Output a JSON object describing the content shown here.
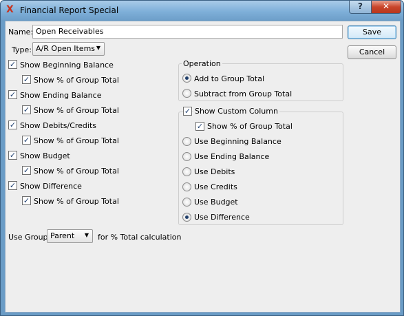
{
  "window": {
    "title": "Financial Report Special",
    "help_glyph": "?",
    "close_glyph": "✕",
    "app_icon_glyph": "X"
  },
  "form": {
    "name_label": "Name:",
    "name_value": "Open Receivables",
    "type_label": "Type:",
    "type_value": "A/R Open Items"
  },
  "buttons": {
    "save": "Save",
    "cancel": "Cancel"
  },
  "show_options": [
    {
      "label": "Show Beginning Balance",
      "checked": true,
      "pct_label": "Show % of Group Total",
      "pct_checked": true
    },
    {
      "label": "Show Ending Balance",
      "checked": true,
      "pct_label": "Show % of Group Total",
      "pct_checked": true
    },
    {
      "label": "Show Debits/Credits",
      "checked": true,
      "pct_label": "Show % of Group Total",
      "pct_checked": true
    },
    {
      "label": "Show Budget",
      "checked": true,
      "pct_label": "Show % of Group Total",
      "pct_checked": true
    },
    {
      "label": "Show Difference",
      "checked": true,
      "pct_label": "Show % of Group Total",
      "pct_checked": true
    }
  ],
  "operation": {
    "title": "Operation",
    "options": [
      {
        "label": "Add to Group Total",
        "selected": true
      },
      {
        "label": "Subtract from Group Total",
        "selected": false
      }
    ]
  },
  "custom_column": {
    "label": "Show Custom Column",
    "checked": true,
    "pct_label": "Show % of Group Total",
    "pct_checked": true,
    "options": [
      {
        "label": "Use Beginning Balance",
        "selected": false
      },
      {
        "label": "Use Ending Balance",
        "selected": false
      },
      {
        "label": "Use Debits",
        "selected": false
      },
      {
        "label": "Use Credits",
        "selected": false
      },
      {
        "label": "Use Budget",
        "selected": false
      },
      {
        "label": "Use Difference",
        "selected": true
      }
    ]
  },
  "use_group": {
    "label": "Use Group",
    "value": "Parent",
    "suffix": "for % Total calculation"
  },
  "icons": {
    "checkmark": "✓",
    "dropdown": "▼"
  },
  "colors": {
    "titlebar": "#7fb0d9",
    "close_button": "#c9462b",
    "dialog_bg": "#eeeeee"
  }
}
